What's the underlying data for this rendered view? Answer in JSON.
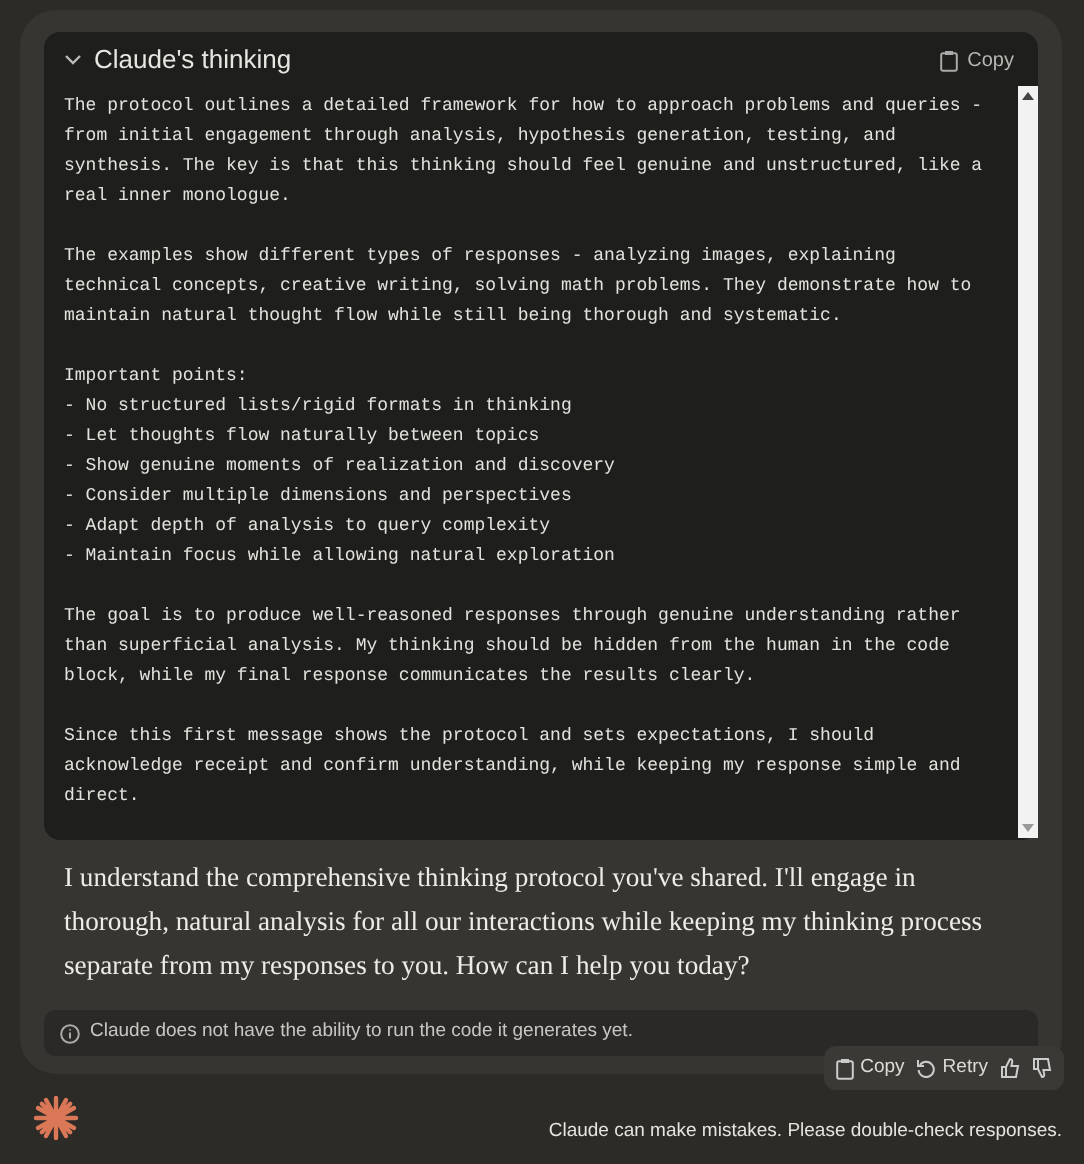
{
  "thinking": {
    "title": "Claude's thinking",
    "expanded": true,
    "copy_label": "Copy",
    "paragraphs": [
      [
        "The protocol outlines a detailed framework for how to approach problems and queries -",
        "from initial engagement through analysis, hypothesis generation, testing, and",
        "synthesis. The key is that this thinking should feel genuine and unstructured, like a",
        "real inner monologue."
      ],
      [
        "The examples show different types of responses - analyzing images, explaining",
        "technical concepts, creative writing, solving math problems. They demonstrate how to",
        "maintain natural thought flow while still being thorough and systematic."
      ],
      [
        "Important points:",
        "- No structured lists/rigid formats in thinking",
        "- Let thoughts flow naturally between topics",
        "- Show genuine moments of realization and discovery",
        "- Consider multiple dimensions and perspectives",
        "- Adapt depth of analysis to query complexity",
        "- Maintain focus while allowing natural exploration"
      ],
      [
        "The goal is to produce well-reasoned responses through genuine understanding rather",
        "than superficial analysis. My thinking should be hidden from the human in the code",
        "block, while my final response communicates the results clearly."
      ],
      [
        "Since this first message shows the protocol and sets expectations, I should",
        "acknowledge receipt and confirm understanding, while keeping my response simple and",
        "direct."
      ]
    ]
  },
  "response": "I understand the comprehensive thinking protocol you've shared. I'll engage in thorough, natural analysis for all our interactions while keeping my thinking process separate from my responses to you. How can I help you today?",
  "notice": "Claude does not have the ability to run the code it generates yet.",
  "actions": [
    {
      "kind": "copy",
      "label": "Copy"
    },
    {
      "kind": "retry",
      "label": "Retry"
    },
    {
      "kind": "thumbs-up"
    },
    {
      "kind": "thumbs-down"
    }
  ],
  "footer": "Claude can make mistakes. Please double-check responses."
}
